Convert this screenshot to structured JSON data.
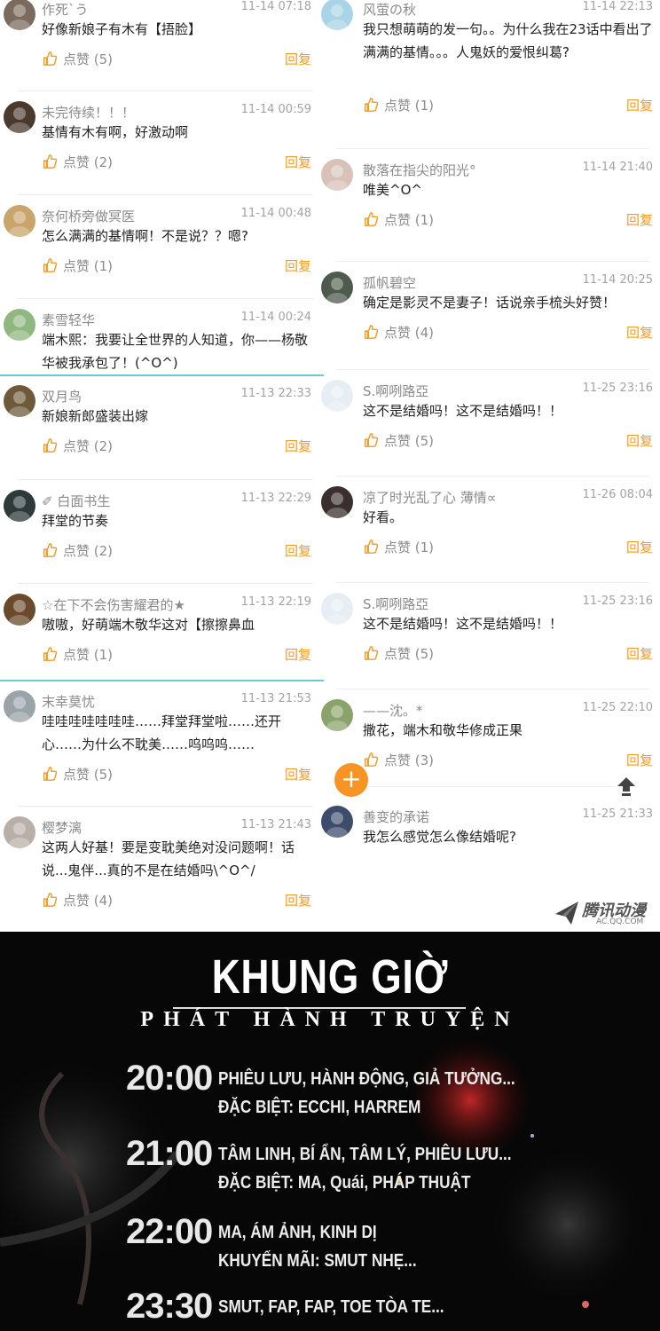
{
  "left_comments": [
    {
      "name": "作死`う",
      "time": "11-14 07:18",
      "text": "好像新娘子有木有【捂脸】",
      "like": "点赞 (5)",
      "reply": "回复",
      "avatar_color": "#7b6a5d"
    },
    {
      "name": "未完待续！！！",
      "time": "11-14 00:59",
      "text": "基情有木有啊，好激动啊",
      "like": "点赞 (2)",
      "reply": "回复",
      "avatar_color": "#4a3a2e"
    },
    {
      "name": "奈何桥旁做冥医",
      "time": "11-14 00:48",
      "text": "怎么满满的基情啊！不是说？？嗯?",
      "like": "点赞 (1)",
      "reply": "回复",
      "avatar_color": "#c9a46b"
    },
    {
      "name": "素雪轻华",
      "time": "11-14 00:24",
      "text": "端木熙：我要让全世界的人知道，你——杨敬华被我承包了！(^O^)",
      "like": "",
      "reply": "",
      "avatar_color": "#8fb880"
    },
    {
      "name": "双月鸟",
      "time": "11-13 22:33",
      "text": "新娘新郎盛装出嫁",
      "like": "点赞 (2)",
      "reply": "回复",
      "avatar_color": "#6e5a3b"
    },
    {
      "name": "✐ 白面书生",
      "time": "11-13 22:29",
      "text": "拜堂的节奏",
      "like": "点赞 (2)",
      "reply": "回复",
      "avatar_color": "#2c3a3a"
    },
    {
      "name": "☆在下不会伤害耀君的★",
      "time": "11-13 22:19",
      "text": "嗷嗷，好萌端木敬华这对【擦擦鼻血",
      "like": "点赞 (1)",
      "reply": "回复",
      "avatar_color": "#6a4a2a"
    },
    {
      "name": "末幸莫忧",
      "time": "11-13 21:53",
      "text": "哇哇哇哇哇哇哇……拜堂拜堂啦……还开心……为什么不耽美……呜呜呜……",
      "like": "点赞 (5)",
      "reply": "回复",
      "avatar_color": "#9aa3a8"
    },
    {
      "name": "樱梦漓",
      "time": "11-13 21:43",
      "text": "这两人好基！要是变耽美绝对没问题啊！话说...鬼伴...真的不是在结婚吗\\^O^/",
      "like": "点赞 (4)",
      "reply": "回复",
      "avatar_color": "#b8b0a8"
    }
  ],
  "right_comments": [
    {
      "name": "风萤の秋",
      "time": "11-14 22:13",
      "text": "我只想萌萌的发一句。。为什么我在23话中看出了满满的基情。。。人鬼妖的爱恨纠葛?",
      "like": "点赞 (1)",
      "reply": "回复",
      "avatar_color": "#a9d3e6"
    },
    {
      "name": "散落在指尖的阳光°",
      "time": "11-14 21:40",
      "text": "唯美^O^",
      "like": "点赞 (1)",
      "reply": "回复",
      "avatar_color": "#d8c2b8"
    },
    {
      "name": "孤帆碧空",
      "time": "11-14 20:25",
      "text": "确定是影灵不是妻子！话说亲手梳头好赞！",
      "like": "点赞 (4)",
      "reply": "回复",
      "avatar_color": "#4d5a4d"
    },
    {
      "name": "S.啊咧路亞",
      "time": "11-25 23:16",
      "text": "这不是结婚吗！这不是结婚吗！！",
      "like": "点赞 (5)",
      "reply": "回复",
      "avatar_color": "#e6eef3"
    },
    {
      "name": "凉了时光乱了心 薄情∝",
      "time": "11-26 08:04",
      "text": "好看。",
      "like": "点赞 (1)",
      "reply": "回复",
      "avatar_color": "#3a2e2e"
    },
    {
      "name": "S.啊咧路亞",
      "time": "11-25 23:16",
      "text": "这不是结婚吗！这不是结婚吗！！",
      "like": "点赞 (5)",
      "reply": "回复",
      "avatar_color": "#e6eef3"
    },
    {
      "name": "——沈。*",
      "time": "11-25 22:10",
      "text": "撒花，端木和敬华修成正果",
      "like": "点赞 (3)",
      "reply": "回复",
      "avatar_color": "#8aa36b"
    },
    {
      "name": "善变的承诺",
      "time": "11-25 21:33",
      "text": "我怎么感觉怎么像结婚呢?",
      "like": "",
      "reply": "",
      "avatar_color": "#3d4c6b"
    }
  ],
  "fab": {
    "label": "+"
  },
  "watermark": {
    "brand": "腾讯动漫",
    "site": "AC.QQ.COM"
  },
  "poster": {
    "title": "KHUNG GIỜ",
    "subtitle": "PHÁT HÀNH TRUYỆN",
    "slots": [
      {
        "time": "20:00",
        "line1": "PHIÊU LƯU, HÀNH ĐỘNG, GIẢ TƯỞNG...",
        "line2": "ĐẶC BIỆT: ECCHI, HARREM"
      },
      {
        "time": "21:00",
        "line1": "TÂM LINH, BÍ ẨN, TÂM LÝ, PHIÊU LƯU...",
        "line2": "ĐẶC BIỆT: MA, Quái, PHÁP THUẬT"
      },
      {
        "time": "22:00",
        "line1": "MA, ÁM ẢNH, KINH DỊ",
        "line2": "KHUYẾN MÃI: SMUT NHẸ..."
      },
      {
        "time": "23:30",
        "line1": "SMUT, FAP, FAP, TOE TÒA TE...",
        "line2": ""
      }
    ]
  }
}
